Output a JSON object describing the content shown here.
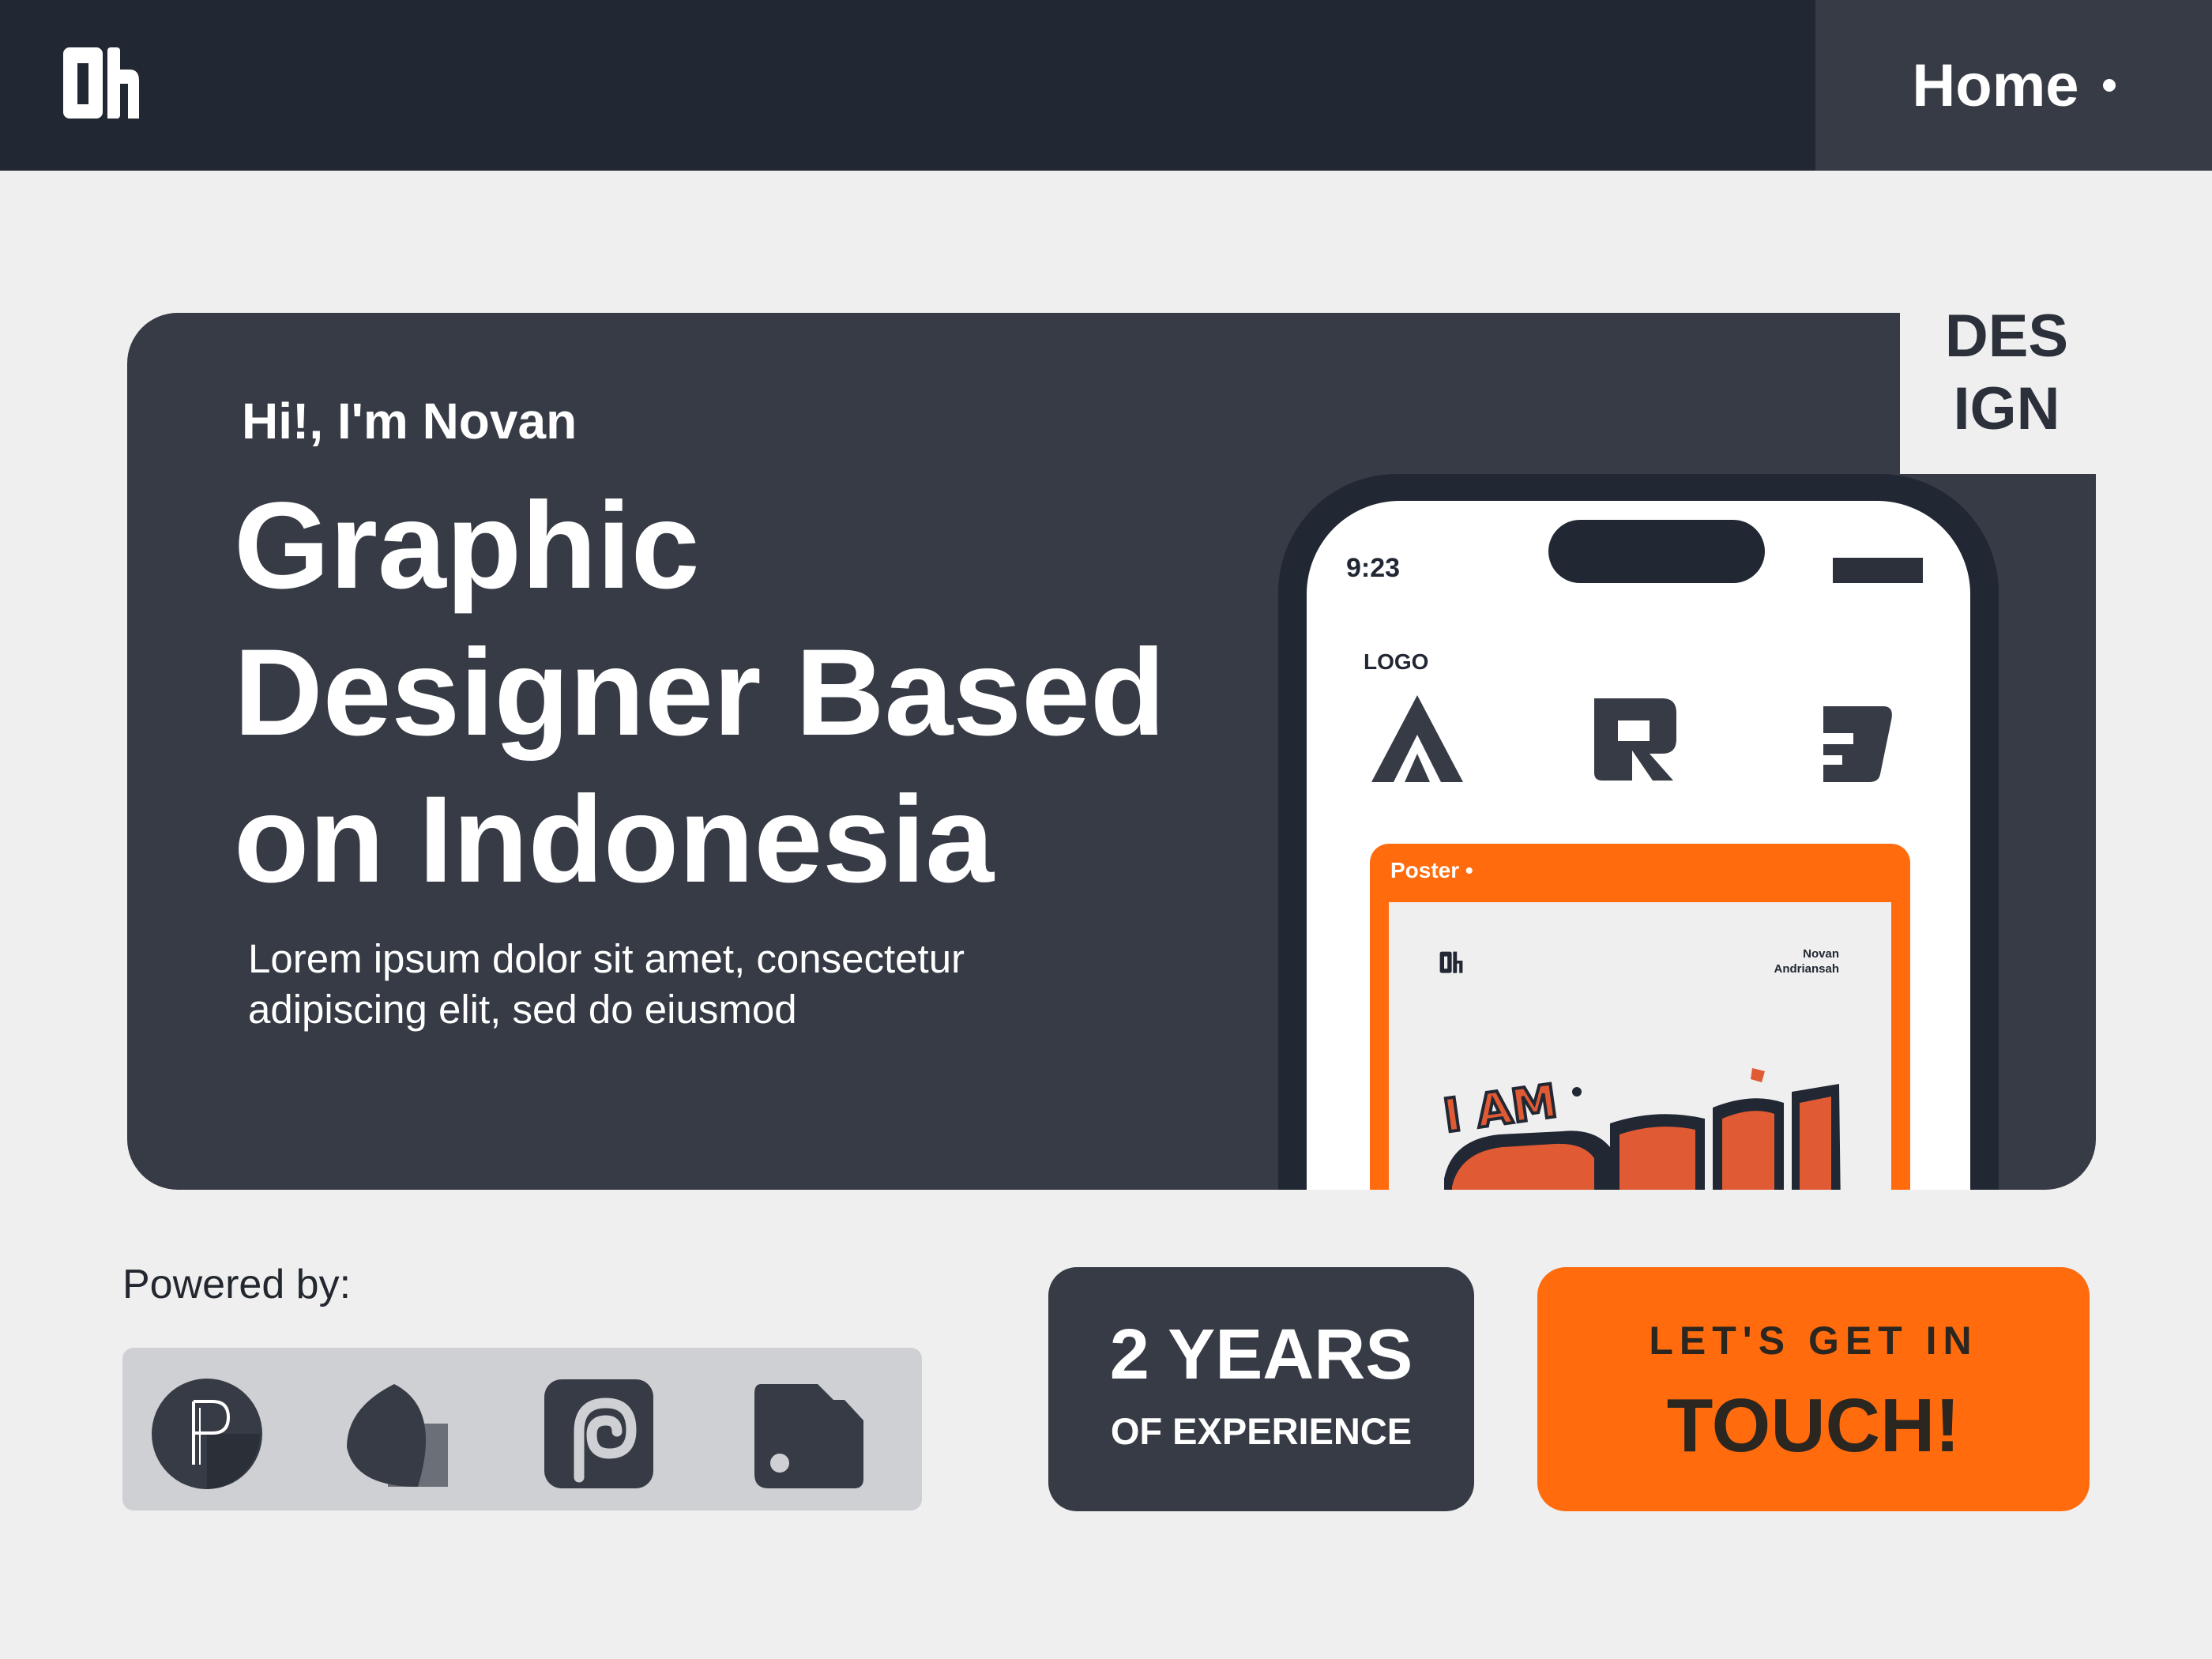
{
  "header": {
    "logo_icon": "brand-logo-icon",
    "nav_home_label": "Home"
  },
  "hero": {
    "design_tag_line1": "DES",
    "design_tag_line2": "IGN",
    "greeting": "Hi!, I'm Novan",
    "title_line1": "Graphic",
    "title_line2": "Designer Based",
    "title_line3": "on Indonesia",
    "desc_line1": "Lorem ipsum dolor sit amet, consectetur",
    "desc_line2": "adipiscing elit, sed do eiusmod"
  },
  "phone": {
    "time": "9:23",
    "logo_section_label": "LOGO",
    "logos": [
      "logo-a-icon",
      "logo-r-icon",
      "logo-b-icon"
    ],
    "poster_label": "Poster •",
    "poster_author_line1": "Novan",
    "poster_author_line2": "Andriansah",
    "poster_art_text": "I AM"
  },
  "powered": {
    "label": "Powered by:",
    "tools": [
      "pixellab-icon",
      "infinite-design-icon",
      "procreate-icon",
      "tool-tag-icon"
    ]
  },
  "experience": {
    "years": "2 YEARS",
    "subtitle": "OF EXPERIENCE"
  },
  "cta": {
    "top": "LET'S GET IN",
    "main": "TOUCH!"
  },
  "colors": {
    "dark_bg": "#222833",
    "card_bg": "#363b45",
    "page_bg": "#efefef",
    "accent": "#ff6b0d"
  }
}
